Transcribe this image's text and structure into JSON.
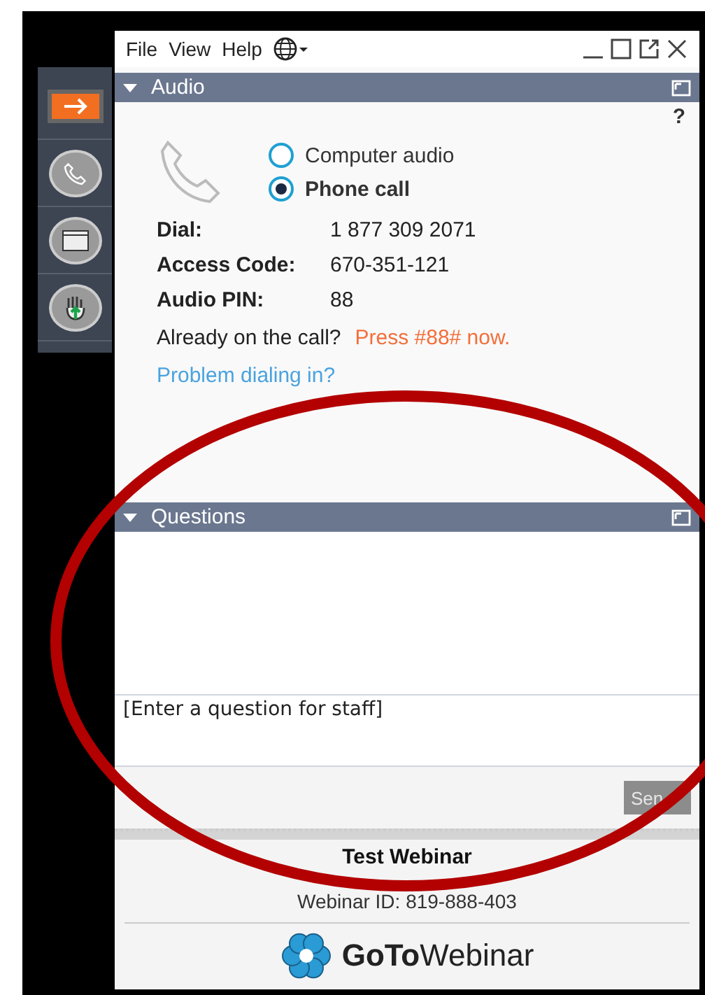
{
  "menu": [
    "File",
    "View",
    "Help"
  ],
  "sidebar": [
    {
      "kind": "arrow",
      "selected": true
    },
    {
      "kind": "phone",
      "selected": false
    },
    {
      "kind": "window",
      "selected": false
    },
    {
      "kind": "hand",
      "selected": false
    }
  ],
  "audio": {
    "title": "Audio",
    "help": "?",
    "options": [
      {
        "label": "Computer audio",
        "selected": false
      },
      {
        "label": "Phone call",
        "selected": true
      }
    ],
    "details": [
      {
        "label": "Dial:",
        "value": "1 877 309 2071"
      },
      {
        "label": "Access Code:",
        "value": "670-351-121"
      },
      {
        "label": "Audio PIN:",
        "value": "88"
      }
    ],
    "already": "Already on the call?",
    "press": "Press #88# now.",
    "link": "Problem dialing in?"
  },
  "questions": {
    "title": "Questions",
    "placeholder": "[Enter a question for staff]",
    "send": "Sen"
  },
  "footer": {
    "webinar": "Test Webinar",
    "webinar_id": "Webinar ID: 819-888-403",
    "logo_bold": "GoTo",
    "logo_light": "Webinar"
  }
}
